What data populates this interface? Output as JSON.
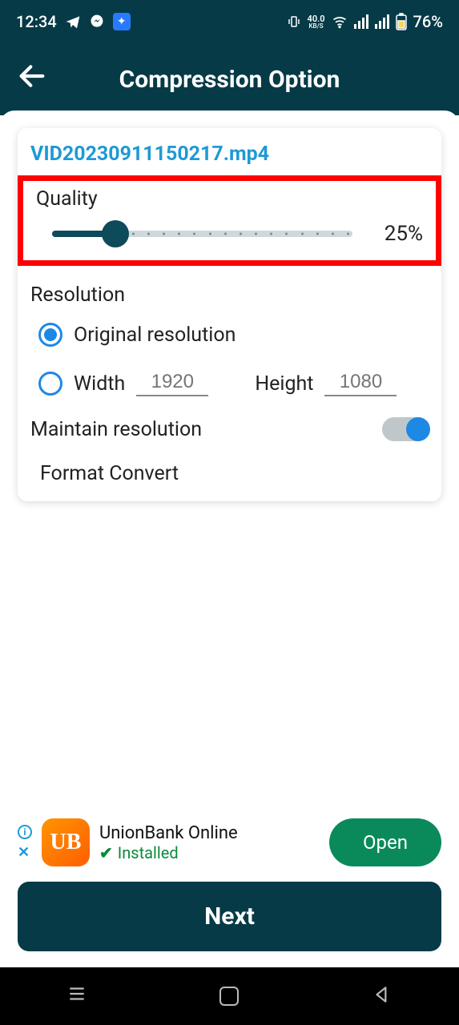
{
  "status": {
    "time": "12:34",
    "speed_val": "40.0",
    "speed_unit": "KB/S",
    "battery": "76%"
  },
  "header": {
    "title": "Compression Option"
  },
  "card": {
    "filename": "VID20230911150217.mp4",
    "quality_label": "Quality",
    "quality_value": "25%",
    "resolution_label": "Resolution",
    "original_label": "Original resolution",
    "width_label": "Width",
    "width_placeholder": "1920",
    "height_label": "Height",
    "height_placeholder": "1080",
    "maintain_label": "Maintain resolution",
    "format_label": "Format Convert"
  },
  "ad": {
    "title": "UnionBank Online",
    "subtitle": "Installed",
    "button": "Open",
    "logo_text": "UB"
  },
  "next_button": "Next"
}
